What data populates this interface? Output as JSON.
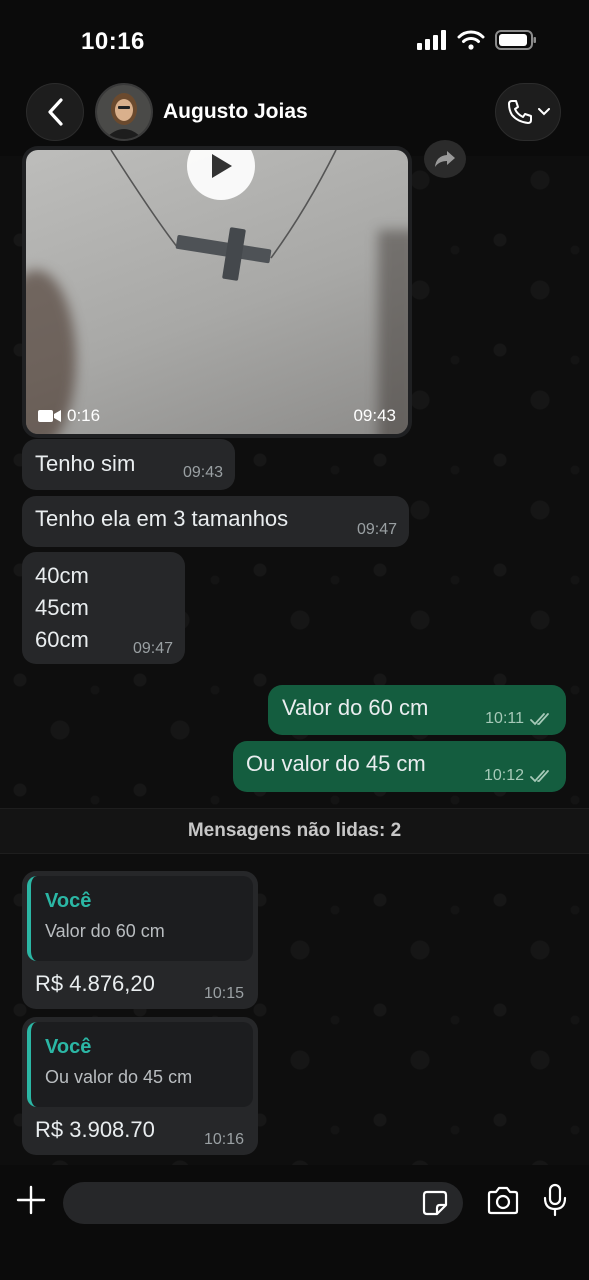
{
  "status_bar": {
    "time": "10:16"
  },
  "header": {
    "contact_name": "Augusto Joias"
  },
  "video": {
    "duration": "0:16",
    "time": "09:43"
  },
  "messages": [
    {
      "text": "Tenho sim",
      "time": "09:43"
    },
    {
      "text": "Tenho ela em 3 tamanhos",
      "time": "09:47"
    },
    {
      "lines": [
        "40cm",
        "45cm",
        "60cm"
      ],
      "time": "09:47"
    },
    {
      "text": "Valor do 60 cm",
      "time": "10:11"
    },
    {
      "text": "Ou valor do 45 cm",
      "time": "10:12"
    }
  ],
  "unread_divider": "Mensagens não lidas: 2",
  "replies": [
    {
      "quote_author": "Você",
      "quote_text": "Valor do 60 cm",
      "text": "R$ 4.876,20",
      "time": "10:15"
    },
    {
      "quote_author": "Você",
      "quote_text": "Ou valor do 45 cm",
      "text": "R$ 3.908.70",
      "time": "10:16"
    }
  ],
  "colors": {
    "outgoing_bubble": "#145d3f",
    "incoming_bubble": "#262729",
    "quote_accent": "#2bb7a5",
    "read_ticks": "#a6c9b8"
  }
}
